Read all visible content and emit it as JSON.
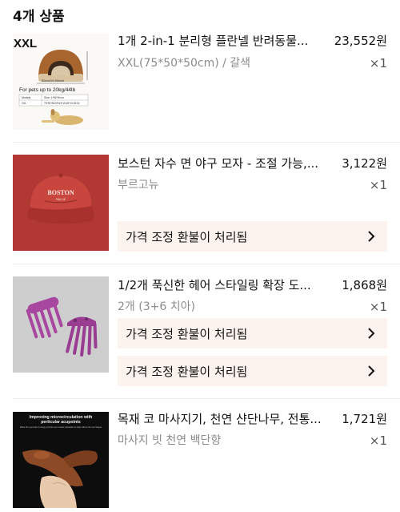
{
  "header": {
    "title": "4개 상품"
  },
  "items": [
    {
      "title": "1개 2-in-1 분리형 플란넬 반려동물...",
      "price": "23,552원",
      "variant": "XXL(75*50*50cm) / 갈색",
      "qty": "×1",
      "thumb": {
        "size_label": "XXL",
        "dims": "50cm/19.69inch",
        "caption": "For pets up to 20kg/44lb",
        "table_col1": "Models",
        "table_col2": "Size: L*W*H/cm",
        "table_row1": "2XL",
        "table_row2": "75*50*50/29.53*19.69*19.69 IN"
      },
      "refunds": []
    },
    {
      "title": "보스턴 자수 면 야구 모자 - 조절 가능,...",
      "price": "3,122원",
      "variant": "부르고뉴",
      "qty": "×1",
      "thumb": {
        "cap_text": "BOSTON",
        "cap_sub": "PAILUE"
      },
      "refunds": [
        "가격 조정 환불이 처리됨"
      ]
    },
    {
      "title": "1/2개 푹신한 헤어 스타일링 확장 도...",
      "price": "1,868원",
      "variant": "2개 (3+6 치아)",
      "qty": "×1",
      "thumb": {},
      "refunds": [
        "가격 조정 환불이 처리됨",
        "가격 조정 환불이 처리됨"
      ]
    },
    {
      "title": "목재 코 마사지기, 천연 샨단나무, 전통...",
      "price": "1,721원",
      "variant": "마사지 빗 천연 백단향",
      "qty": "×1",
      "thumb": {
        "headline": "Improving microcirculation with",
        "headline2": "perticular acupoints",
        "sub": "Make the eyes full of energy and the eye muscle relaxation to help relieve the eye fatigue"
      },
      "refunds": []
    }
  ],
  "colors": {
    "refund_bg": "#fdf3ee",
    "muted": "#8c8c8c",
    "hat": "#b33a36",
    "comb": "#a3449c"
  }
}
